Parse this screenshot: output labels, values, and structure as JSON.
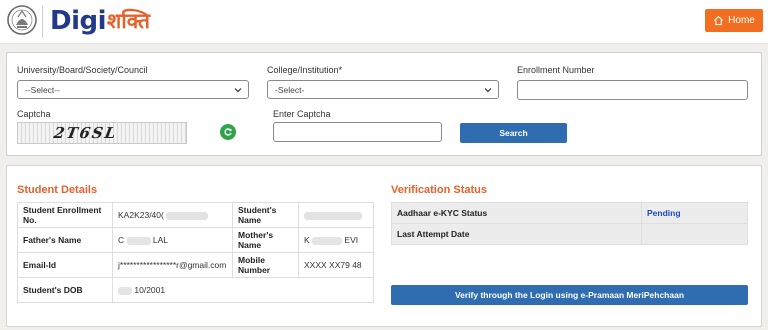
{
  "header": {
    "logo_digi": "Digi",
    "logo_shakti": "शक्ति",
    "home_label": "Home"
  },
  "search": {
    "university_label": "University/Board/Society/Council",
    "university_value": "--Select--",
    "college_label": "College/Institution*",
    "college_value": "-Select-",
    "enrollment_label": "Enrollment Number",
    "enrollment_value": "",
    "captcha_label": "Captcha",
    "captcha_text": "2T6SL",
    "enter_captcha_label": "Enter Captcha",
    "enter_captcha_value": "",
    "search_button": "Search"
  },
  "student": {
    "title": "Student Details",
    "enrollment_key": "Student Enrollment No.",
    "enrollment_value": "KA2K23/40(",
    "name_key": "Student's Name",
    "name_value": "",
    "father_key": "Father's Name",
    "father_value_a": "C",
    "father_value_b": "LAL",
    "mother_key": "Mother's Name",
    "mother_value_a": "K",
    "mother_value_b": "EVI",
    "email_key": "Email-Id",
    "email_value": "j*****************r@gmail.com",
    "mobile_key": "Mobile Number",
    "mobile_value": "XXXX XX79 48",
    "dob_key": "Student's DOB",
    "dob_value": "10/2001"
  },
  "verification": {
    "title": "Verification Status",
    "ekyc_key": "Aadhaar e-KYC Status",
    "ekyc_value": "Pending",
    "last_attempt_key": "Last Attempt Date",
    "last_attempt_value": "",
    "verify_button": "Verify through the Login using e-Pramaan MeriPehchaan"
  },
  "colors": {
    "accent": "#f26f21",
    "primary_button": "#2f6db0",
    "section_title": "#e8612c",
    "pending": "#1f45c2"
  }
}
